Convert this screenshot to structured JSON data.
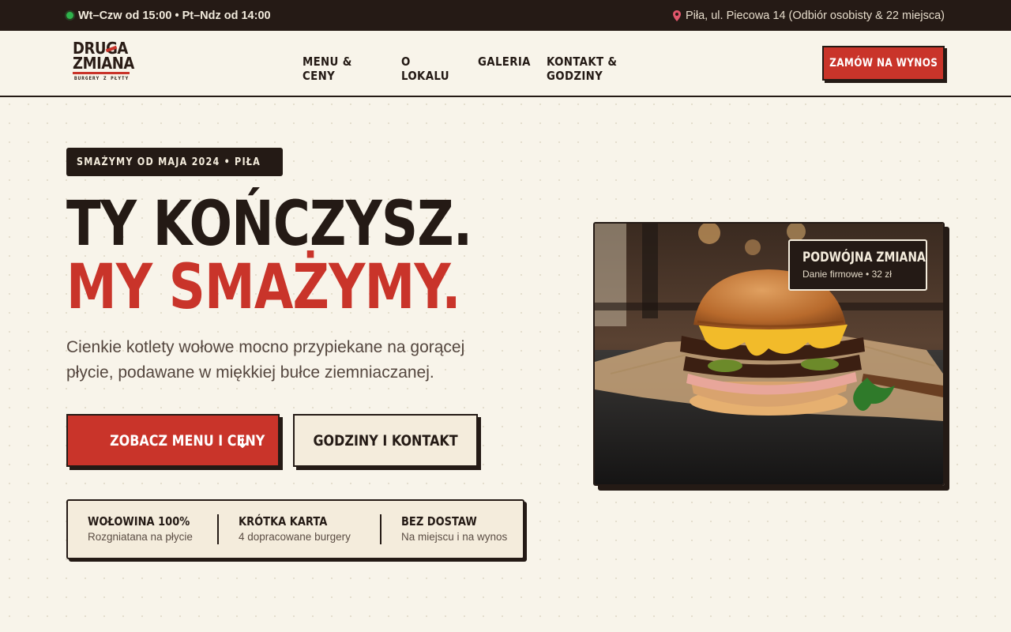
{
  "topbar": {
    "hours": "Wt–Czw od 15:00 • Pt–Ndz od 14:00",
    "address": "Piła, ul. Piecowa 14 (Odbiór osobisty & 22 miejsca)",
    "status_color": "#2fb34c"
  },
  "logo": {
    "line1": "DRUGA",
    "line2": "ZMIANA",
    "tagline": "BURGERY Z PŁYTY"
  },
  "nav": {
    "items": [
      {
        "label": "MENU & CENY"
      },
      {
        "label": "O LOKALU"
      },
      {
        "label": "GALERIA"
      },
      {
        "label": "KONTAKT & GODZINY"
      }
    ],
    "cta": "ZAMÓW NA WYNOS"
  },
  "hero": {
    "badge": "SMAŻYMY OD MAJA 2024 • PIŁA",
    "headline_line1": "TY KOŃCZYSZ.",
    "headline_line2": "MY SMAŻYMY.",
    "lead": "Cienkie kotlety wołowe mocno przypiekane na gorącej płycie, podawane w miękkiej bułce ziemniaczanej.",
    "primary_button": "ZOBACZ MENU I CENY",
    "secondary_button": "GODZINY I KONTAKT",
    "features": [
      {
        "title": "WOŁOWINA 100%",
        "subtitle": "Rozgniatana na płycie"
      },
      {
        "title": "KRÓTKA KARTA",
        "subtitle": "4 dopracowane burgery"
      },
      {
        "title": "BEZ DOSTAW",
        "subtitle": "Na miejscu i na wynos"
      }
    ],
    "photo_tag": {
      "title": "PODWÓJNA ZMIANA",
      "subtitle": "Danie firmowe • 32 zł"
    }
  },
  "colors": {
    "accent": "#c9342a",
    "dark": "#241a15",
    "background": "#f8f4ea",
    "card": "#f4ecdc"
  },
  "icons": {
    "status": "status-dot-icon",
    "location": "map-pin-icon",
    "arrow": "arrow-down-icon",
    "photo": "burger-photo"
  }
}
